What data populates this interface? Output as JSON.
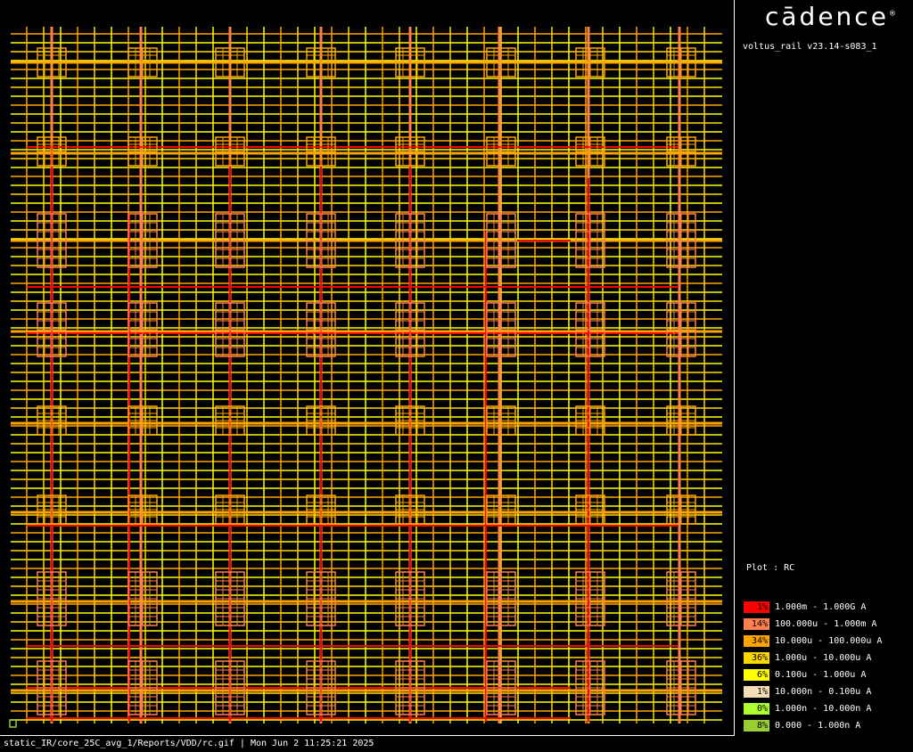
{
  "header": {
    "logo_text": "cādence",
    "version": "voltus_rail v23.14-s083_1"
  },
  "plot": {
    "label": "Plot : RC"
  },
  "legend": {
    "items": [
      {
        "pct": "1%",
        "range": "1.000m - 1.000G A",
        "color": "#ff0000"
      },
      {
        "pct": "14%",
        "range": "100.000u - 1.000m A",
        "color": "#ff7f50"
      },
      {
        "pct": "34%",
        "range": "10.000u - 100.000u A",
        "color": "#ffa500"
      },
      {
        "pct": "36%",
        "range": "1.000u - 10.000u A",
        "color": "#ffd700"
      },
      {
        "pct": "6%",
        "range": "0.100u - 1.000u A",
        "color": "#ffff00"
      },
      {
        "pct": "1%",
        "range": "10.000n - 0.100u A",
        "color": "#f5deb3"
      },
      {
        "pct": "0%",
        "range": "1.000n - 10.000n A",
        "color": "#adff2f"
      },
      {
        "pct": "8%",
        "range": "0.000 - 1.000n A",
        "color": "#9acd32"
      }
    ]
  },
  "footer": {
    "text": "static_IR/core_25C_avg_1/Reports/VDD/rc.gif | Mon Jun  2 11:25:21 2025"
  }
}
